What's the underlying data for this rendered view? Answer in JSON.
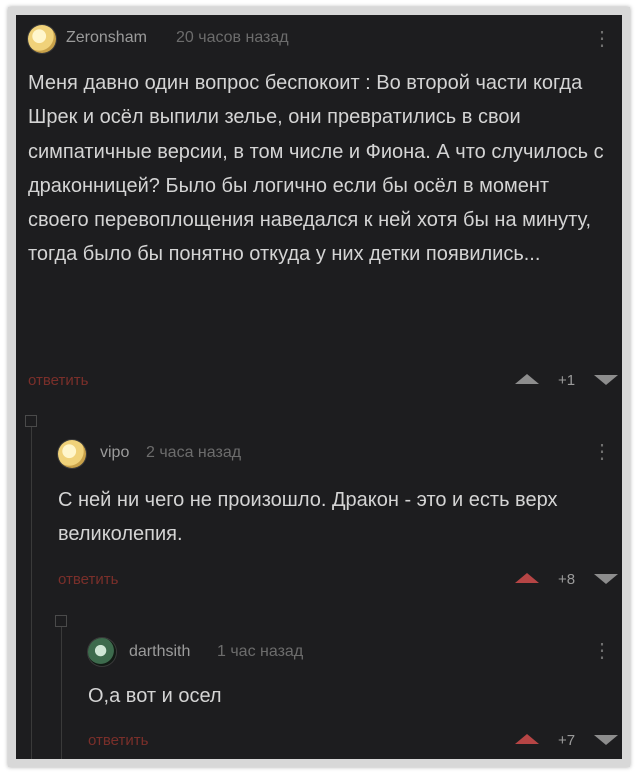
{
  "comments": [
    {
      "author": "Zeronsham",
      "time": "20 часов назад",
      "text": "Меня давно один вопрос беспокоит : Во второй части когда Шрек и осёл выпили зелье, они превратились в свои симпатичные версии, в том числе и Фиона. А что случилось с драконницей? Было бы логично если бы осёл в момент своего перевоплощения наведался к ней хотя бы на минуту, тогда было бы понятно откуда у них детки появились...",
      "reply_label": "ответить",
      "score": "+1",
      "menu_glyph": "⋮"
    },
    {
      "author": "vipo",
      "time": "2 часа назад",
      "text": "С ней ни чего не произошло. Дракон - это и есть верх великолепия.",
      "reply_label": "ответить",
      "score": "+8",
      "menu_glyph": "⋮"
    },
    {
      "author": "darthsith",
      "time": "1 час назад",
      "text": "О,а вот и осел",
      "reply_label": "ответить",
      "score": "+7",
      "menu_glyph": "⋮"
    }
  ],
  "colors": {
    "background": "#1d1d1f",
    "reply_link": "#7a2f2a",
    "upvoted": "#b64545",
    "text": "#d4d4d4"
  },
  "icons": [
    "avatar",
    "kebab-menu-icon",
    "upvote-icon",
    "downvote-icon",
    "collapse-thread-icon"
  ]
}
